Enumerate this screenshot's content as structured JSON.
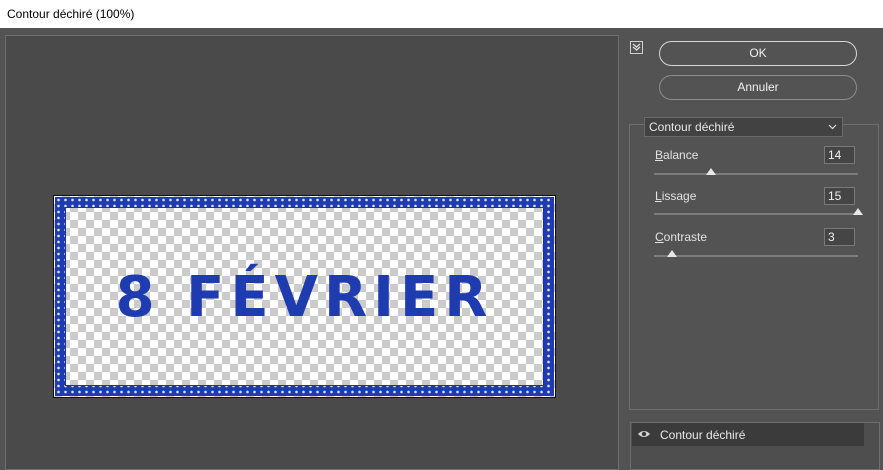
{
  "window": {
    "title": "Contour déchiré (100%)"
  },
  "preview": {
    "stamp_text": "8 FÉVRIER",
    "stamp_color": "#1f3bb0"
  },
  "buttons": {
    "ok": "OK",
    "cancel": "Annuler"
  },
  "filter_select": {
    "value": "Contour déchiré"
  },
  "params": [
    {
      "label_first": "B",
      "label_rest": "alance",
      "value": "14",
      "fraction": 0.28
    },
    {
      "label_first": "L",
      "label_rest": "issage",
      "value": "15",
      "fraction": 1.0
    },
    {
      "label_first": "C",
      "label_rest": "ontraste",
      "value": "3",
      "fraction": 0.09
    }
  ],
  "layers": [
    {
      "name": "Contour déchiré",
      "visible_icon": "eye-icon"
    }
  ]
}
